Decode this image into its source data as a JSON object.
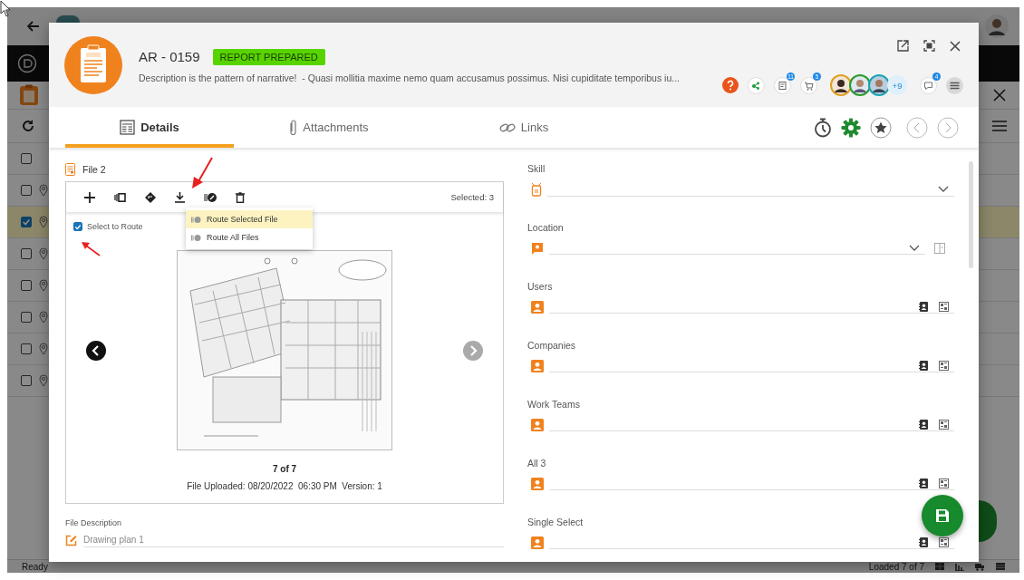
{
  "app": {
    "select_all_checked": false,
    "rows": [
      {
        "checked": false
      },
      {
        "checked": true
      },
      {
        "checked": false
      },
      {
        "checked": false
      },
      {
        "checked": false
      },
      {
        "checked": false
      },
      {
        "checked": false
      }
    ],
    "status": "Ready",
    "loaded": "Loaded 7 of 7"
  },
  "dialog": {
    "record_id": "AR - 0159",
    "status_badge": "REPORT PREPARED",
    "description": "Description is the pattern of narrative!  - Quasi mollitia maxime nemo quam accusamus possimus. Nisi cupiditate temporibus iu...",
    "badges": {
      "tasks": "11",
      "cart": "5",
      "chat": "4"
    },
    "more_people": "+9",
    "tabs": [
      {
        "label": "Details",
        "kind": "details",
        "selected": true
      },
      {
        "label": "Attachments",
        "kind": "attachments",
        "selected": false
      },
      {
        "label": "Links",
        "kind": "links",
        "selected": false
      }
    ],
    "file_panel": {
      "title": "File 2",
      "selected_count": "Selected: 3",
      "route_menu": [
        {
          "label": "Route Selected File",
          "selected": true
        },
        {
          "label": "Route All Files",
          "selected": false
        }
      ],
      "select_to_route": {
        "label": "Select to Route",
        "checked": true
      },
      "pager": "7 of 7",
      "meta": "File Uploaded: 08/20/2022  06:30 PM  Version: 1"
    },
    "file_description": {
      "label": "File Description",
      "value": "Drawing plan 1"
    },
    "fields": [
      {
        "label": "Skill",
        "kind": "skill"
      },
      {
        "label": "Location",
        "kind": "location"
      },
      {
        "label": "Users",
        "kind": "people"
      },
      {
        "label": "Companies",
        "kind": "people"
      },
      {
        "label": "Work Teams",
        "kind": "people"
      },
      {
        "label": "All 3",
        "kind": "people"
      },
      {
        "label": "Single Select",
        "kind": "people"
      }
    ]
  }
}
